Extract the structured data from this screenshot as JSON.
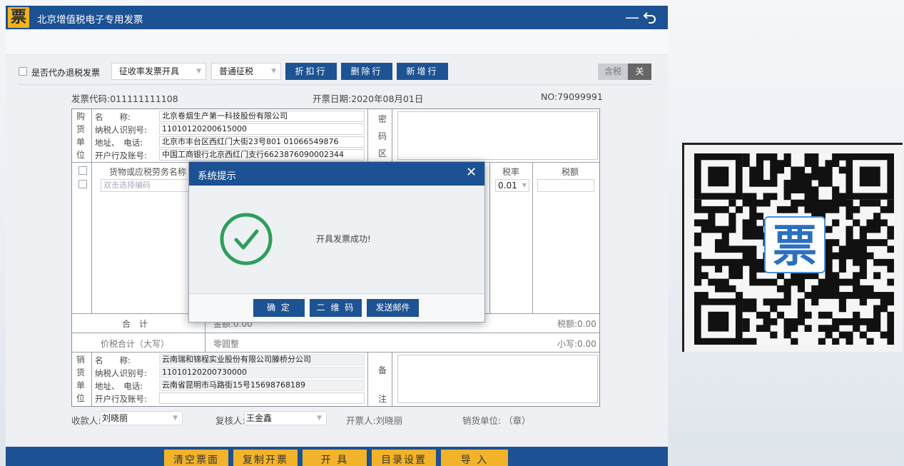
{
  "app": {
    "title": "北京增值税电子专用发票",
    "logo_char": "票",
    "minimize": "—",
    "back": "⮌"
  },
  "toolbar": {
    "refund_label": "是否代办退税发票",
    "mode_select": "征收率发票开具",
    "tax_type_select": "普通征税",
    "discount_btn": "折扣行",
    "delete_btn": "删除行",
    "add_btn": "新增行",
    "tax_incl": "含税",
    "tax_off": "关"
  },
  "invoice": {
    "code": "发票代码:011111111108",
    "date": "开票日期:2020年08月01日",
    "no": "NO:79099991",
    "buyer_side": [
      "购",
      "货",
      "单",
      "位"
    ],
    "buyer": {
      "name_label": "名　　称:",
      "name": "北京卷烟生产第一科技股份有限公司",
      "taxid_label": "纳税人识别号:",
      "taxid": "11010120200615000",
      "addr_label": "地址、　电话:",
      "addr": "北京市丰台区西红门大街23号801 01066549876",
      "bank_label": "开户行及账号:",
      "bank": "中国工商银行北京西红门支行6623876090002344"
    },
    "cipher_side": [
      "密",
      "码",
      "区"
    ],
    "col_goods": "货物或应税劳务名称",
    "goods_placeholder": "双击选择编码",
    "col_rate": "税率",
    "col_tax": "税额",
    "rate_value": "0.01",
    "total_label": "合　计",
    "total_amount": "金额:0.00",
    "total_tax": "税额:0.00",
    "sum_words_label": "价税合计（大写）",
    "sum_words": "零圆整",
    "sum_small": "小写:0.00",
    "seller_side": [
      "销",
      "货",
      "单",
      "位"
    ],
    "seller": {
      "name_label": "名　　称:",
      "name": "云南瑞和锦程实业股份有限公司滕桥分公司",
      "taxid_label": "纳税人识别号:",
      "taxid": "11010120200730000",
      "addr_label": "地址、　电话:",
      "addr": "云南省昆明市马路街15号15698768189",
      "bank_label": "开户行及账号:",
      "bank": ""
    },
    "note_side": [
      "备",
      "注"
    ],
    "payee_label": "收款人:",
    "payee": "刘晓丽",
    "reviewer_label": "复核人:",
    "reviewer": "王金鑫",
    "drawer": "开票人:刘晓丽",
    "seller_stamp": "销货单位: （章）"
  },
  "bottom": {
    "clear": "清空票面",
    "copy": "复制开票",
    "issue": "开 具",
    "catalog": "目录设置",
    "import": "导 入"
  },
  "dialog": {
    "title": "系统提示",
    "close": "✕",
    "message": "开具发票成功!",
    "ok": "确 定",
    "qrcode": "二 维 码",
    "email": "发送邮件"
  },
  "qr": {
    "center_char": "票"
  },
  "colors": {
    "brand": "#1c5193",
    "button_yellow": "#f2b32b",
    "success": "#2e9e5b"
  }
}
